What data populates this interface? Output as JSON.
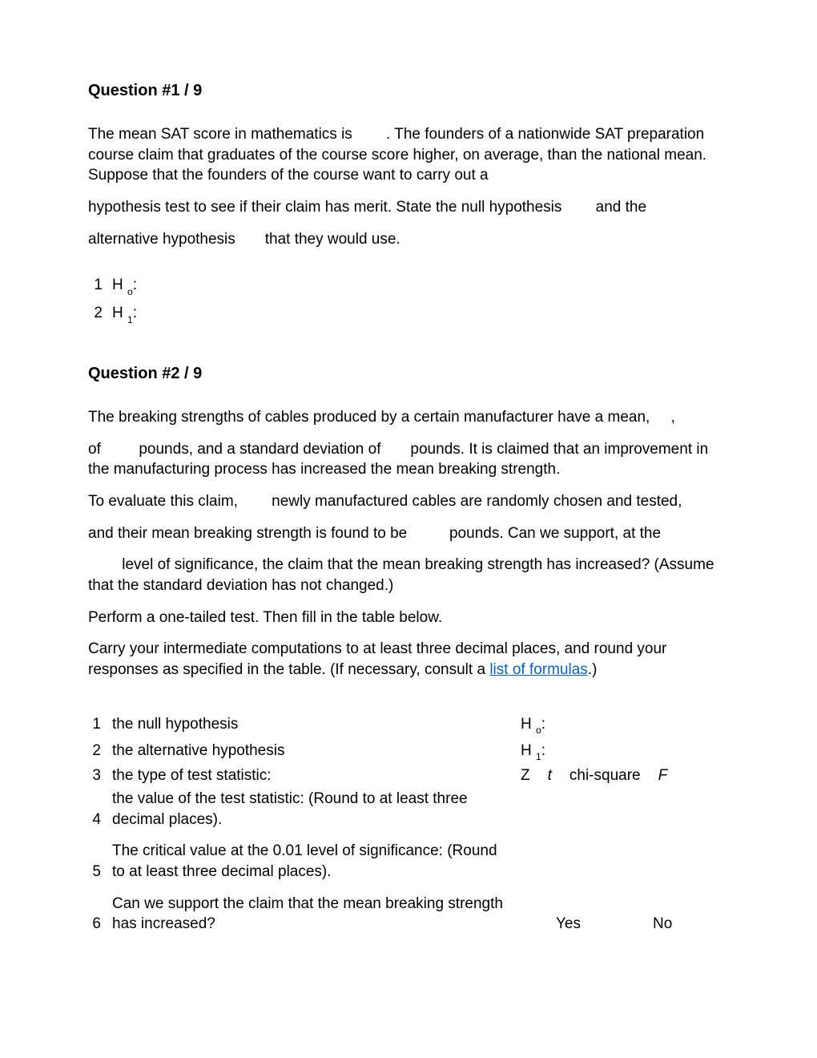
{
  "q1": {
    "title": "Question #1 / 9",
    "para1": "The mean SAT score in mathematics is        . The founders of a nationwide SAT preparation course claim that graduates of the course score higher, on average, than the national mean. Suppose that the founders of the course want to carry out a",
    "para2": "hypothesis test to see if their claim has merit. State the null hypothesis        and the",
    "para3": "alternative hypothesis       that they would use.",
    "items": [
      {
        "num": "1",
        "label_a": "H ",
        "label_sub": "o",
        "label_b": ":"
      },
      {
        "num": "2",
        "label_a": "H ",
        "label_sub": "1",
        "label_b": ":"
      }
    ]
  },
  "q2": {
    "title": "Question #2 / 9",
    "para1": "The breaking strengths of cables produced by a certain manufacturer have a mean,     ,",
    "para2": "of         pounds, and a standard deviation of       pounds. It is claimed that an improvement in the manufacturing process has increased the mean breaking strength.",
    "para3": "To evaluate this claim,        newly manufactured cables are randomly chosen and tested,",
    "para4": "and their mean breaking strength is found to be          pounds. Can we support, at the",
    "para5": "        level of significance, the claim that the mean breaking strength has increased? (Assume that the standard deviation has not changed.)",
    "para6": "Perform a one-tailed test. Then fill in the table below.",
    "para7a": "Carry your intermediate computations to at least three decimal places, and round your responses as specified in the table. (If necessary, consult a ",
    "link": "list of formulas",
    "para7b": ".)",
    "rows": {
      "r1": {
        "num": "1",
        "desc": "the null hypothesis",
        "ans_pre": "H ",
        "ans_sub": "o",
        "ans_post": ":"
      },
      "r2": {
        "num": "2",
        "desc": "the alternative hypothesis",
        "ans_pre": "H ",
        "ans_sub": "1",
        "ans_post": ":"
      },
      "r3": {
        "num": "3",
        "desc": "the type of test statistic:",
        "opts": {
          "z": "Z",
          "t": "t",
          "chi": "chi-square",
          "f": "F"
        }
      },
      "r4": {
        "num": "4",
        "desc": "the value of the test statistic: (Round to at least three decimal places)."
      },
      "r5": {
        "num": "5",
        "desc": "The critical value at the 0.01 level of significance: (Round to at least three decimal places)."
      },
      "r6": {
        "num": "6",
        "desc": "Can we support the claim that the mean breaking strength has increased?",
        "yes": "Yes",
        "no": "No"
      }
    }
  }
}
